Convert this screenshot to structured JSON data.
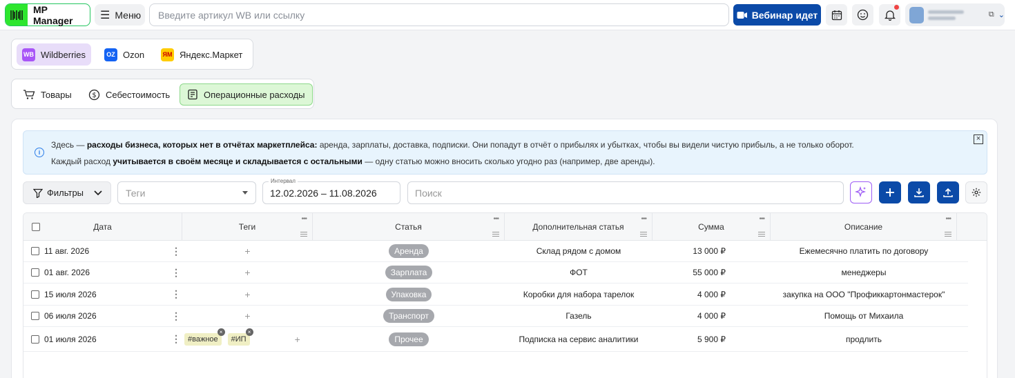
{
  "topbar": {
    "brand": "MP Manager",
    "menu_label": "Меню",
    "search_placeholder": "Введите артикул WB или ссылку",
    "webinar_label": "Вебинар идет",
    "accent": "#0b4aa8",
    "icons": [
      "calendar-icon",
      "smile-icon",
      "bell-icon"
    ]
  },
  "marketplaces": [
    {
      "badge": "WB",
      "label": "Wildberries",
      "color": "#a855f7",
      "active": true
    },
    {
      "badge": "OZ",
      "label": "Ozon",
      "color": "#1463f3",
      "active": false
    },
    {
      "badge": "ЯМ",
      "label": "Яндекс.Маркет",
      "color": "#ffcc00",
      "active": false
    }
  ],
  "sections": [
    {
      "label": "Товары",
      "icon": "cart-icon",
      "active": false
    },
    {
      "label": "Себестоимость",
      "icon": "coin-icon",
      "active": false
    },
    {
      "label": "Операционные расходы",
      "icon": "receipt-icon",
      "active": true
    }
  ],
  "info": {
    "l1_a": "Здесь — ",
    "l1_b": "расходы бизнеса, которых нет в отчётах маркетплейса:",
    "l1_c": " аренда, зарплаты, доставка, подписки. Они попадут в отчёт о прибылях и убытках, чтобы вы видели чистую прибыль, а не только оборот.",
    "l2_a": "Каждый расход ",
    "l2_b": "учитывается в своём месяце и складывается с остальными",
    "l2_c": "  — одну статью можно вносить сколько угодно раз (например, две аренды)."
  },
  "toolbar": {
    "filters_label": "Фильтры",
    "tags_placeholder": "Теги",
    "interval_label": "Интервал",
    "interval_value": "12.02.2026 – 11.08.2026",
    "search_placeholder": "Поиск"
  },
  "table": {
    "headers": [
      "Дата",
      "Теги",
      "Статья",
      "Дополнительная статья",
      "Сумма",
      "Описание"
    ],
    "rows": [
      {
        "date": "11 авг. 2026",
        "tags": [],
        "category": "Аренда",
        "extra": "Склад рядом с домом",
        "sum": "13 000 ₽",
        "desc": "Ежемесячно платить по договору"
      },
      {
        "date": "01 авг. 2026",
        "tags": [],
        "category": "Зарплата",
        "extra": "ФОТ",
        "sum": "55 000 ₽",
        "desc": "менеджеры"
      },
      {
        "date": "15 июля 2026",
        "tags": [],
        "category": "Упаковка",
        "extra": "Коробки для набора тарелок",
        "sum": "4 000 ₽",
        "desc": "закупка на ООО \"Профиккартонмастерок\""
      },
      {
        "date": "06 июля 2026",
        "tags": [],
        "category": "Транспорт",
        "extra": "Газель",
        "sum": "4 000 ₽",
        "desc": "Помощь от Михаила"
      },
      {
        "date": "01 июля 2026",
        "tags": [
          "#важное",
          "#ИП"
        ],
        "category": "Прочее",
        "extra": "Подписка на сервис аналитики",
        "sum": "5 900 ₽",
        "desc": "продлить"
      }
    ]
  }
}
